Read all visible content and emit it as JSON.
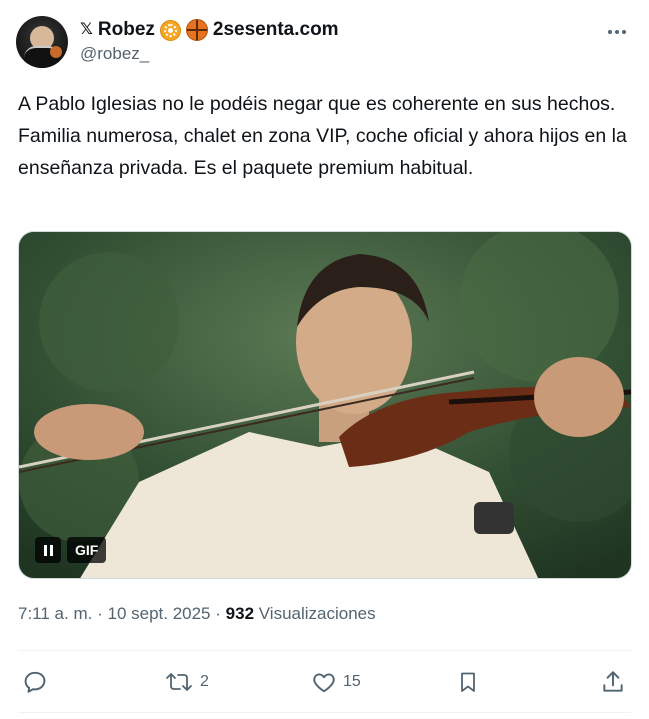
{
  "user": {
    "x_logo": "𝕏",
    "display_name": "Robez",
    "site": "2sesenta.com",
    "handle": "@robez_",
    "badge_icons": [
      "radioactive-icon",
      "basketball-icon"
    ]
  },
  "tweet": {
    "text": "A Pablo Iglesias no le podéis negar que es coherente en sus hechos. Familia numerosa, chalet en zona VIP, coche oficial y ahora hijos en la enseñanza privada. Es el paquete premium habitual."
  },
  "media": {
    "gif_label": "GIF"
  },
  "meta": {
    "time": "7:11 a. m.",
    "sep1": "·",
    "date": "10 sept. 2025",
    "sep2": "·",
    "views_count": "932",
    "views_label": "Visualizaciones"
  },
  "actions": {
    "reply_count": "",
    "retweet_count": "2",
    "like_count": "15"
  },
  "colors": {
    "text": "#0f1419",
    "secondary": "#536471",
    "divider": "#eff3f4"
  }
}
